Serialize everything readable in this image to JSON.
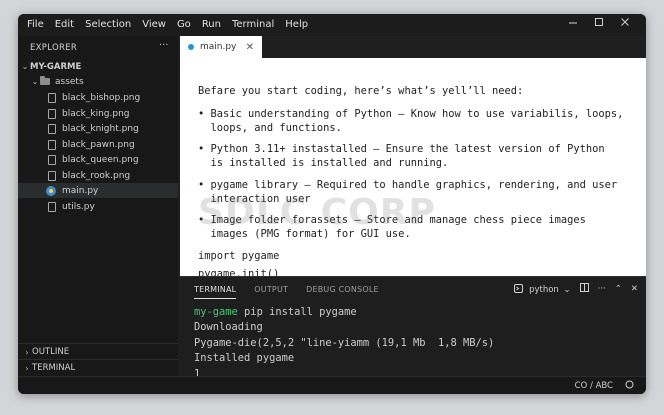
{
  "menu": [
    "File",
    "Edit",
    "Selection",
    "View",
    "Go",
    "Run",
    "Terminal",
    "Help"
  ],
  "explorer": {
    "title": "EXPLORER",
    "more": "···",
    "root": "MY-GARME",
    "folder": "assets",
    "files": [
      "black_bishop.png",
      "black_king.png",
      "black_knight.png",
      "black_pawn.png",
      "black_queen.png",
      "black_rook.png"
    ],
    "main_file": "main.py",
    "utils_file": "utils.py",
    "outline": "OUTLINE",
    "terminal": "TERMINAL"
  },
  "tab": {
    "label": "main.py",
    "close": "✕"
  },
  "editor": {
    "intro": "Befare you start coding, here’s what’s yell’ll need:",
    "b1_l1": "• Basic understanding of Python — Know how to use variabilis, loops,",
    "b1_l2": "  loops, and functions.",
    "b2_l1": "• Python 3.11+ instastalled — Ensure the latest version of Python",
    "b2_l2": "  is installed is installed and running.",
    "b3_l1": "• pygame library — Required to handle graphics, rendering, and user",
    "b3_l2": "  interaction user",
    "b4_l1": "• Image folder forassets — Store and manage chess piece images",
    "b4_l2": "  images (PMG format) for GUI use.",
    "code1": "import pygame",
    "code2": "pygame.init()",
    "watermark": "SDLC CORP"
  },
  "panel": {
    "tabs": [
      "TERMINAL",
      "OUTPUT",
      "DEBUG CONSOLE"
    ],
    "shell": "python",
    "term_prompt": "my-game",
    "term_cmd": " pip install pygame",
    "term_l2": "Downloading",
    "term_l3": "Pygame-die(2,5,2 \"line-yiamm (19,1 Mb  1,8 MB/s)",
    "term_l4": "Installed pygame",
    "term_l5": "1"
  },
  "status": {
    "encoding": "CO / ABC"
  },
  "colors": {
    "accent": "#1f9bd1",
    "prompt": "#3ec77c",
    "python_blue": "#3b8bd6"
  }
}
